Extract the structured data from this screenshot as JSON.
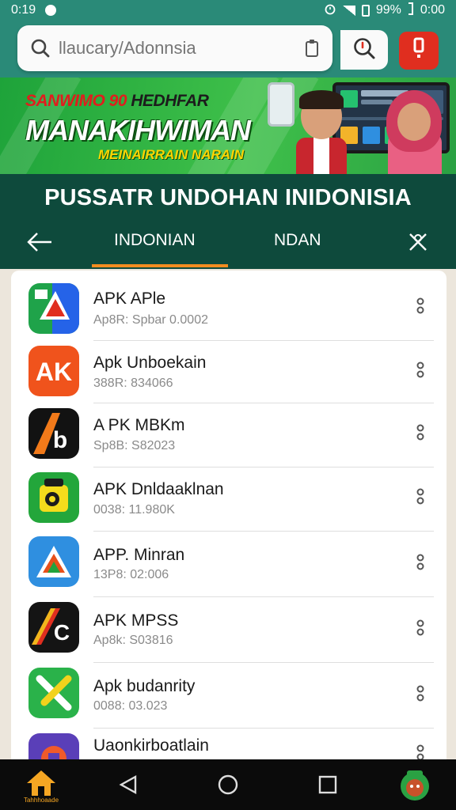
{
  "status_bar": {
    "time": "0:19",
    "battery": "99%",
    "clock_right": "0:00"
  },
  "search": {
    "placeholder": "llaucary/Adonnsia"
  },
  "banner": {
    "line1_red": "SANWIMO 90",
    "line1_dark": "HEDHFAR",
    "line2": "MANAKIHWIMAN",
    "line3": "MEINAIRRAIN NARAIN"
  },
  "page_title": "PUSSATR UNDOHAN INIDONISIA",
  "tabs": [
    {
      "label": "INDONIAN",
      "active": true
    },
    {
      "label": "NDAN",
      "active": false
    }
  ],
  "apps": [
    {
      "title": "APK APle",
      "subtitle": "Ap8R: Spbar 0.0002",
      "icon": "blue-green-arrow-app-icon"
    },
    {
      "title": "Apk Unboekain",
      "subtitle": "388R: 834066",
      "icon": "orange-ak-app-icon"
    },
    {
      "title": "A PK MBKm",
      "subtitle": "Sp8B: S82023",
      "icon": "black-orange-a-app-icon"
    },
    {
      "title": "APK Dnldaaklnan",
      "subtitle": "0038: 11.980K",
      "icon": "green-yellow-camera-app-icon"
    },
    {
      "title": "APP. Minran",
      "subtitle": "13P8: 02:006",
      "icon": "blue-triangle-app-icon"
    },
    {
      "title": "APK MPSS",
      "subtitle": "Ap8k: S03816",
      "icon": "black-ac-app-icon"
    },
    {
      "title": "Apk budanrity",
      "subtitle": "0088: 03.023",
      "icon": "green-x-app-icon"
    },
    {
      "title": "Uaonkirboatlain",
      "subtitle": "",
      "icon": "purple-orange-app-icon"
    }
  ],
  "nav": {
    "home_label": "Tahhhoaade"
  },
  "colors": {
    "header_teal": "#2a8a78",
    "title_band": "#0e4a3c",
    "tab_underline": "#f28c20",
    "alert_red": "#e02e1f",
    "banner_green": "#3fc04a"
  }
}
